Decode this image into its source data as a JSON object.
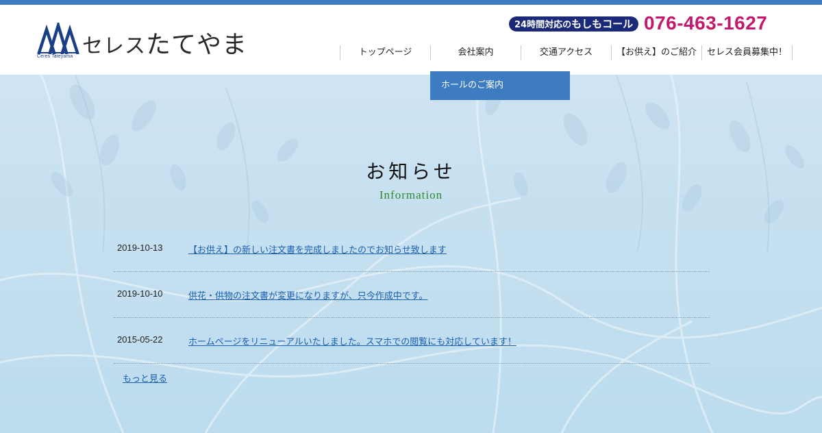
{
  "colors": {
    "accent": "#3e7cc1",
    "brand_navy": "#1b2a78",
    "phone": "#c4186c",
    "subtitle": "#2f8a2b",
    "link": "#1a5fb0"
  },
  "header": {
    "logo_icon": "tateyama-mountain-logo",
    "logo_sub": "Ceres Tateyama",
    "logo_text_a": "セレス",
    "logo_text_b": "たてやま",
    "call_label_small": "24時間対応の",
    "call_label_big": "もしもコール",
    "phone": "076-463-1627"
  },
  "nav": {
    "items": [
      {
        "label": "トップページ"
      },
      {
        "label": "会社案内"
      },
      {
        "label": "交通アクセス"
      },
      {
        "label": "【お供え】のご紹介"
      },
      {
        "label": "セレス会員募集中！"
      }
    ],
    "dropdown_item": "ホールのご案内"
  },
  "main": {
    "title": "お知らせ",
    "subtitle": "Information",
    "news": [
      {
        "date": "2019-10-13",
        "title": "【お供え】の新しい注文書を完成しましたのでお知らせ致します"
      },
      {
        "date": "2019-10-10",
        "title": "供花・供物の注文書が変更になりますが、只今作成中です。"
      },
      {
        "date": "2015-05-22",
        "title": "ホームページをリニューアルいたしました。スマホでの閲覧にも対応しています！"
      }
    ],
    "more": "もっと見る"
  }
}
